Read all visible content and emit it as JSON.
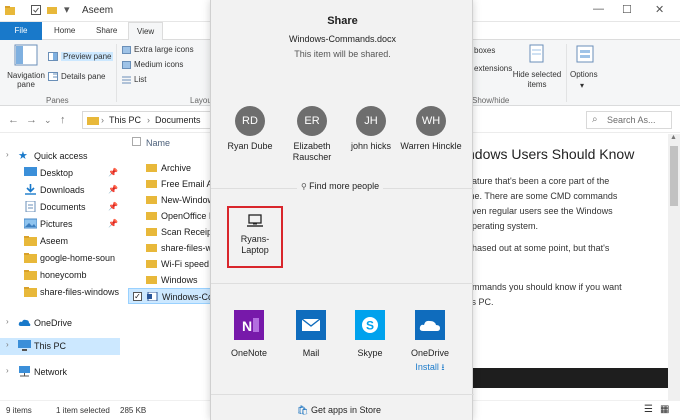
{
  "explorer": {
    "title": "Aseem",
    "tabs": [
      "File",
      "Home",
      "Share",
      "View"
    ],
    "active_tab": "View",
    "ribbon": {
      "navigation_pane": "Navigation pane",
      "preview_pane": "Preview pane",
      "details_pane": "Details pane",
      "panes_group": "Panes",
      "extra_large_icons": "Extra large icons",
      "medium_icons": "Medium icons",
      "list": "List",
      "layout_group": "Layou",
      "boxes": "boxes",
      "extensions": "extensions",
      "hide_selected": "Hide selected items",
      "options": "Options",
      "show_hide_group": "Show/hide"
    },
    "address": {
      "crumbs": [
        "This PC",
        "Documents"
      ]
    },
    "search_placeholder": "Search As...",
    "nav": {
      "quick_access": "Quick access",
      "items": [
        "Desktop",
        "Downloads",
        "Documents",
        "Pictures",
        "Aseem",
        "google-home-soun",
        "honeycomb",
        "share-files-windows"
      ],
      "onedrive": "OneDrive",
      "this_pc": "This PC",
      "network": "Network"
    },
    "files": {
      "column_name": "Name",
      "rows": [
        "Archive",
        "Free Email A",
        "New-Window",
        "OpenOffice I",
        "Scan Receipt",
        "share-files-w",
        "Wi-Fi speed",
        "Windows",
        "Windows-Co"
      ]
    },
    "preview": {
      "heading": "ndows Users Should Know",
      "lines": [
        "eature that's been a core part of the",
        "me. There are some CMD commands",
        "even regular users see the Windows",
        "operating system.",
        "phased out at some point, but that's",
        "ommands you should know if you want",
        "vs PC."
      ]
    },
    "status": {
      "count": "9 items",
      "selected": "1 item selected",
      "size": "285 KB"
    }
  },
  "share": {
    "title": "Share",
    "filename": "Windows-Commands.docx",
    "note": "This item will be shared.",
    "contacts": [
      {
        "initials": "RD",
        "name": "Ryan Dube"
      },
      {
        "initials": "ER",
        "name": "Elizabeth Rauscher"
      },
      {
        "initials": "JH",
        "name": "john hicks"
      },
      {
        "initials": "WH",
        "name": "Warren Hinckle"
      }
    ],
    "find_more": "Find more people",
    "device": "Ryans-Laptop",
    "apps": [
      {
        "name": "OneNote",
        "color": "#7719aa"
      },
      {
        "name": "Mail",
        "color": "#0f6cbd"
      },
      {
        "name": "Skype",
        "color": "#00a2ed"
      },
      {
        "name": "OneDrive",
        "color": "#0f6cbd",
        "install": "Install ⭳"
      }
    ],
    "store": "Get apps in Store"
  },
  "colors": {
    "accent": "#1979ca",
    "highlight": "#d9262c",
    "selection": "#cce8ff"
  }
}
